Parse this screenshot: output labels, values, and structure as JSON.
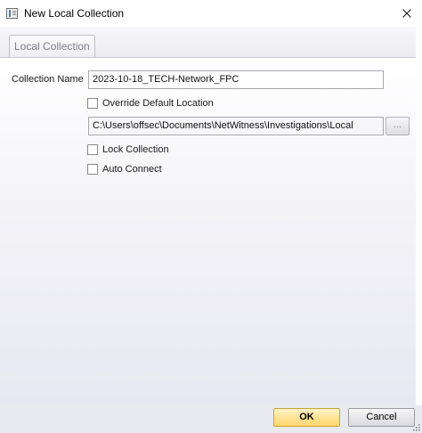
{
  "window": {
    "title": "New Local Collection",
    "close_label": "✕"
  },
  "tabs": [
    {
      "label": "Local Collection",
      "active": true
    }
  ],
  "form": {
    "collection_name_label": "Collection Name",
    "collection_name_value": "2023-10-18_TECH-Network_FPC",
    "override_location_label": "Override Default Location",
    "override_location_checked": false,
    "location_value": "C:\\Users\\offsec\\Documents\\NetWitness\\Investigations\\Local",
    "browse_label": "...",
    "lock_collection_label": "Lock Collection",
    "lock_collection_checked": false,
    "auto_connect_label": "Auto Connect",
    "auto_connect_checked": false
  },
  "footer": {
    "ok_label": "OK",
    "cancel_label": "Cancel"
  },
  "colors": {
    "ok_button": "#ffd56b",
    "ok_border": "#c9a33b",
    "panel_gradient_end": "#e8e8f0"
  }
}
